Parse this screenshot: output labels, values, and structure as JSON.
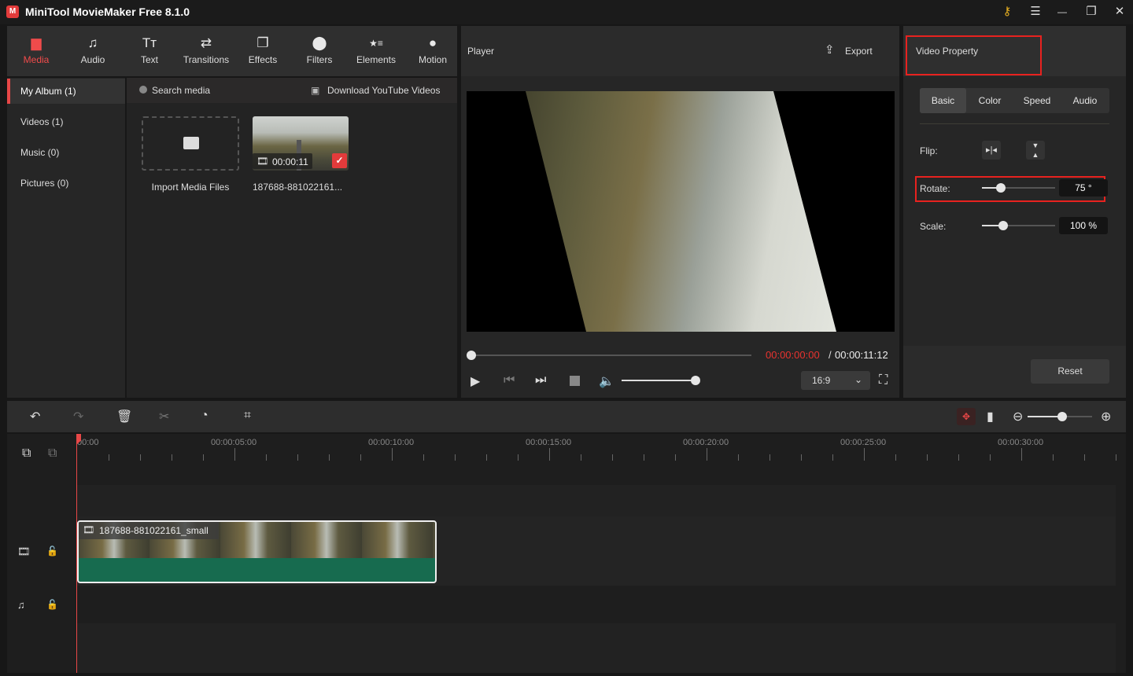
{
  "app": {
    "title": "MiniTool MovieMaker Free 8.1.0"
  },
  "window_controls": [
    {
      "icon": "key-icon",
      "glyph": "🔑"
    },
    {
      "icon": "menu-icon",
      "glyph": "☰"
    },
    {
      "icon": "minimize-icon",
      "glyph": "—"
    },
    {
      "icon": "maximize-icon",
      "glyph": "❐"
    },
    {
      "icon": "close-icon",
      "glyph": "✕"
    }
  ],
  "main_tabs": [
    {
      "label": "Media",
      "icon": "folder-icon",
      "glyph": "▬",
      "active": true
    },
    {
      "label": "Audio",
      "icon": "music-icon",
      "glyph": "♫"
    },
    {
      "label": "Text",
      "icon": "text-icon",
      "glyph": "Tт"
    },
    {
      "label": "Transitions",
      "icon": "transitions-icon",
      "glyph": "⇄"
    },
    {
      "label": "Effects",
      "icon": "effects-icon",
      "glyph": "❐"
    },
    {
      "label": "Filters",
      "icon": "filters-icon",
      "glyph": "⬤"
    },
    {
      "label": "Elements",
      "icon": "elements-icon",
      "glyph": "★≡"
    },
    {
      "label": "Motion",
      "icon": "motion-icon",
      "glyph": "●"
    }
  ],
  "sidebar": {
    "items": [
      {
        "label": "My Album (1)",
        "active": true
      },
      {
        "label": "Videos (1)"
      },
      {
        "label": "Music (0)"
      },
      {
        "label": "Pictures (0)"
      }
    ]
  },
  "media": {
    "search_placeholder": "Search media",
    "download_label": "Download YouTube Videos",
    "import_label": "Import Media Files",
    "clip": {
      "name": "187688-881022161...",
      "duration": "00:00:11",
      "selected": true
    }
  },
  "player": {
    "title": "Player",
    "export_label": "Export",
    "current_time": "00:00:00:00",
    "separator": "/",
    "total_time": "00:00:11:12",
    "aspect_ratio": "16:9",
    "progress": 0,
    "volume": 1.0
  },
  "property": {
    "title": "Video Property",
    "tabs": [
      {
        "label": "Basic",
        "active": true
      },
      {
        "label": "Color"
      },
      {
        "label": "Speed"
      },
      {
        "label": "Audio"
      }
    ],
    "flip_label": "Flip:",
    "rotate_label": "Rotate:",
    "rotate_value": "75 °",
    "rotate_degrees": 75,
    "scale_label": "Scale:",
    "scale_value": "100 %",
    "scale_percent": 100,
    "reset_label": "Reset"
  },
  "timeline": {
    "ruler": [
      "00:00",
      "00:00:05:00",
      "00:00:10:00",
      "00:00:15:00",
      "00:00:20:00",
      "00:00:25:00",
      "00:00:30:00"
    ],
    "clip_name": "187688-881022161_small",
    "accent": "#e84747",
    "clip_color": "#176b4f"
  }
}
